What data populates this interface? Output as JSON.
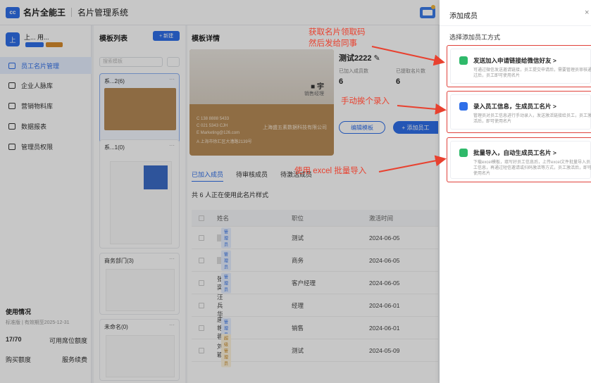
{
  "topbar": {
    "logo": "cc",
    "brand": "名片全能王",
    "system": "名片管理系统"
  },
  "sidebar": {
    "org_avatar": "上",
    "org_name": "上... 用...",
    "items": [
      {
        "label": "员工名片管理",
        "active": true
      },
      {
        "label": "企业人脉库",
        "active": false
      },
      {
        "label": "营销物料库",
        "active": false
      },
      {
        "label": "数据报表",
        "active": false
      },
      {
        "label": "管理员权限",
        "active": false
      }
    ],
    "usage_title": "使用情况",
    "usage_sub": "标准版 | 有效期至2025-12-31",
    "used": "17/70",
    "quota_label": "可用席位额度",
    "buy_label": "购买额度",
    "renew_label": "服务续费"
  },
  "templates": {
    "title": "模板列表",
    "new_label": "+ 新建",
    "search_placeholder": "搜索模板",
    "cards": [
      {
        "name": "系...2(6)"
      },
      {
        "name": "系...1(0)"
      },
      {
        "name": "商务部门(3)"
      },
      {
        "name": "未命名(0)"
      }
    ]
  },
  "detail": {
    "title": "模板详情",
    "template_name": "测试2222",
    "stat1_label": "已加入成员数",
    "stat1_value": "6",
    "stat2_label": "已提取名片数",
    "stat2_value": "6",
    "edit_label": "编辑模板",
    "add_label": "+ 添加员工",
    "card_title": "销售经理",
    "card_company": "上海盛五素数据科技有限公司",
    "card_info": [
      "C 138 8888 5433",
      "C 021 5343 CJH",
      "E Marketing@126.com",
      "A 上海市徐汇区大漕路2139号"
    ],
    "tabs": [
      "已加入成员",
      "待审核成员",
      "待激活成员"
    ],
    "count_text": "共 6 人正在使用此名片样式",
    "headers": {
      "name": "姓名",
      "position": "职位",
      "time": "激活时间"
    },
    "rows": [
      {
        "name": "",
        "badge": "管理员",
        "badge_style": "blue",
        "position": "测试",
        "time": "2024-06-05"
      },
      {
        "name": "",
        "badge": "管理员",
        "badge_style": "blue",
        "position": "商务",
        "time": "2024-06-05"
      },
      {
        "name": "张奕",
        "badge": "管理员",
        "badge_style": "blue",
        "position": "客户经理",
        "time": "2024-06-05"
      },
      {
        "name": "汪兵华",
        "badge": "",
        "badge_style": "",
        "position": "经理",
        "time": "2024-06-01"
      },
      {
        "name": "唐艳蓉",
        "badge": "管理员",
        "badge_style": "blue",
        "position": "销售",
        "time": "2024-06-01"
      },
      {
        "name": "刘颖",
        "badge": "超级管理员",
        "badge_style": "gold",
        "position": "测试",
        "time": "2024-05-09"
      }
    ]
  },
  "drawer": {
    "title": "添加成员",
    "close": "×",
    "subtitle": "选择添加员工方式",
    "options": [
      {
        "icon": "wechat-icon",
        "title": "发送加入申请链接给微信好友 >",
        "desc": "可通过微信发送邀请链接，员工提交申请后，需要管理员审核通过后，员工即可使用名片"
      },
      {
        "icon": "edit-icon",
        "title": "录入员工信息，生成员工名片 >",
        "desc": "管理员对员工信息进行手动录入，发送激活链接给员工，员工激活后，即可使用名片"
      },
      {
        "icon": "excel-icon",
        "title": "批量导入，自动生成员工名片 >",
        "desc": "下载excel模板，填写好员工信息后，上传excel文件批量导入员工信息，再通过短信邀请或扫码激活等方式，员工激活后，即可使用名片"
      }
    ]
  },
  "annotations": {
    "a1_line1": "获取名片领取码",
    "a1_line2": "然后发给同事",
    "a2": "手动挨个录入",
    "a3": "使用 excel 批量导入",
    "color": "#e8412f"
  }
}
